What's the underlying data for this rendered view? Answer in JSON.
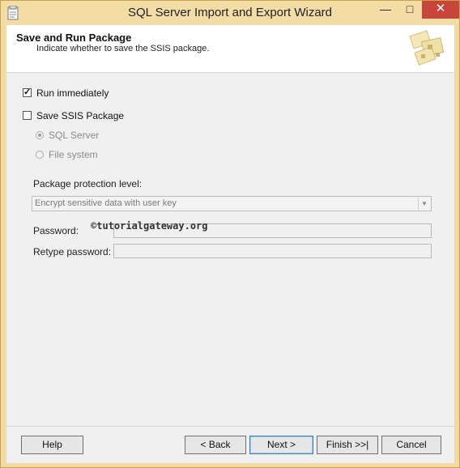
{
  "window": {
    "title": "SQL Server Import and Export Wizard",
    "minimize_glyph": "—",
    "maximize_glyph": "□",
    "close_glyph": "✕",
    "app_icon": "wizard-app-icon",
    "close_color": "#c7453b"
  },
  "header": {
    "title": "Save and Run Package",
    "subtitle": "Indicate whether to save the SSIS package.",
    "graphic_icon": "package-graphic-icon"
  },
  "options": {
    "run_immediately": {
      "label": "Run immediately",
      "checked": true
    },
    "save_ssis_package": {
      "label": "Save SSIS Package",
      "checked": false
    },
    "storage": [
      {
        "label": "SQL Server",
        "selected": true,
        "enabled": false
      },
      {
        "label": "File system",
        "selected": false,
        "enabled": false
      }
    ]
  },
  "protection": {
    "label": "Package protection level:",
    "selected_value": "Encrypt sensitive data with user key",
    "dropdown_icon": "chevron-down-icon"
  },
  "fields": {
    "password_label": "Password:",
    "password_value": "",
    "retype_label": "Retype password:",
    "retype_value": ""
  },
  "watermark": "©tutorialgateway.org",
  "buttons": {
    "help": "Help",
    "back": "< Back",
    "next": "Next >",
    "finish": "Finish >>|",
    "cancel": "Cancel"
  }
}
